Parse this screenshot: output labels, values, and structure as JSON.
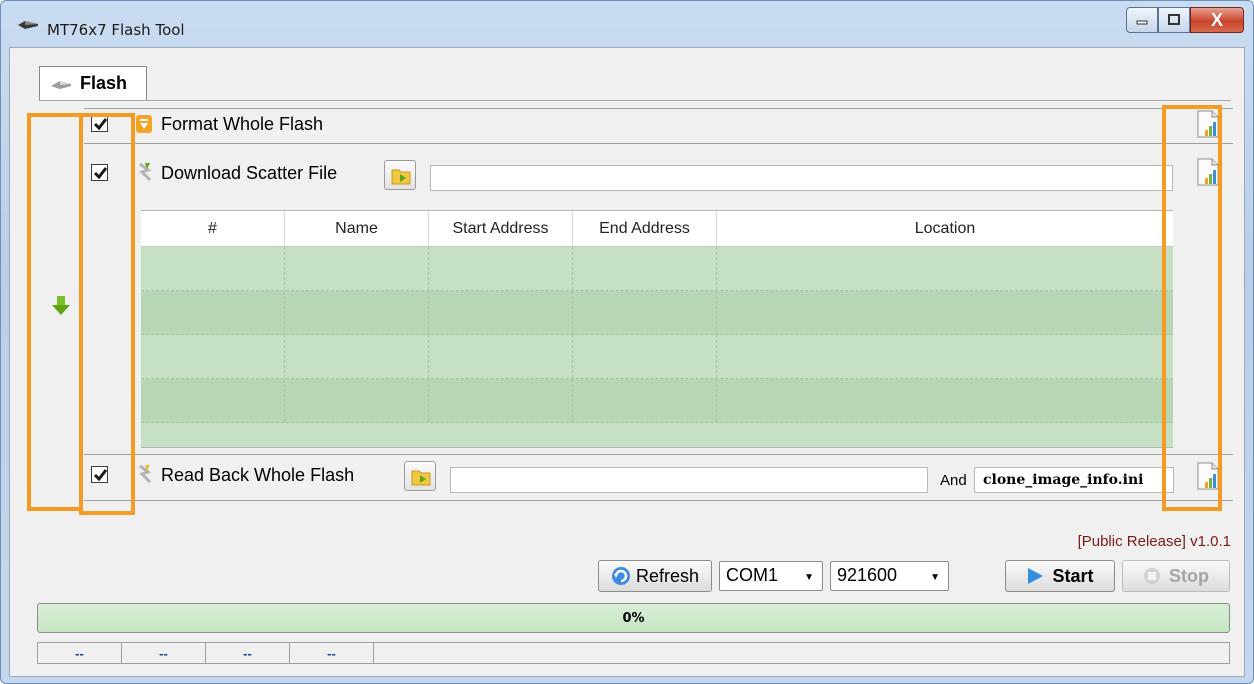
{
  "window": {
    "title": "MT76x7 Flash Tool",
    "close_glyph": "X"
  },
  "tabs": [
    {
      "label": "Flash"
    }
  ],
  "rows": {
    "format": {
      "label": "Format Whole Flash",
      "checked": true
    },
    "download": {
      "label": "Download Scatter File",
      "checked": true,
      "path_value": ""
    },
    "readback": {
      "label": "Read Back Whole Flash",
      "checked": true,
      "path_value": "",
      "and_label": "And",
      "ini_value": "clone_image_info.ini"
    }
  },
  "table": {
    "columns": [
      "#",
      "Name",
      "Start Address",
      "End Address",
      "Location"
    ],
    "rows": [
      [
        "",
        "",
        "",
        "",
        ""
      ],
      [
        "",
        "",
        "",
        "",
        ""
      ],
      [
        "",
        "",
        "",
        "",
        ""
      ],
      [
        "",
        "",
        "",
        "",
        ""
      ]
    ]
  },
  "version": "[Public Release] v1.0.1",
  "controls": {
    "refresh_label": "Refresh",
    "port_value": "COM1",
    "baud_value": "921600",
    "start_label": "Start",
    "stop_label": "Stop"
  },
  "progress": {
    "text": "0%",
    "value": 0
  },
  "statusbar": [
    "--",
    "--",
    "--",
    "--",
    ""
  ],
  "colors": {
    "highlight": "#f59a23",
    "table_row": "#c6e0c4",
    "progress": "#c6e6c3",
    "version_text": "#7b1a1a"
  },
  "icons": [
    "window-app-icon",
    "flash-tab-icon",
    "down-arrow-icon",
    "format-icon",
    "download-icon",
    "readback-icon",
    "folder-icon",
    "doc-chart-icon",
    "refresh-icon",
    "start-play-icon",
    "stop-icon"
  ]
}
